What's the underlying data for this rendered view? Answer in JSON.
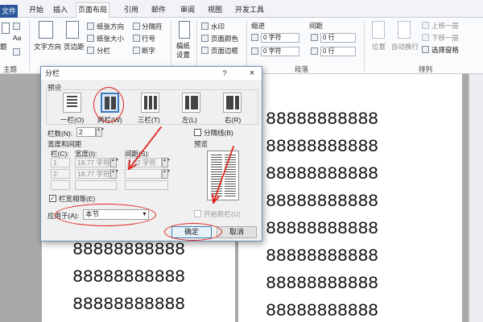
{
  "ribbon": {
    "tabs": [
      "文件",
      "开始",
      "插入",
      "页面布局",
      "引用",
      "邮件",
      "审阅",
      "视图",
      "开发工具"
    ],
    "active_tab": "页面布局",
    "page_setup": {
      "text_direction": "文字方向",
      "margins": "页边距",
      "orientation": "纸张方向",
      "size": "纸张大小",
      "columns": "分栏",
      "breaks": "分隔符",
      "line_numbers": "行号",
      "hyphenation": "断字"
    },
    "manuscript": "稿纸\n设置",
    "page_bg": {
      "watermark": "水印",
      "page_color": "页面颜色",
      "page_borders": "页面边框"
    },
    "paragraph": {
      "indent": "缩进",
      "spacing": "间距",
      "indent_left": "0 字符",
      "indent_right": "0 字符",
      "spacing_before": "0 行",
      "spacing_after": "0 行",
      "group_label": "段落"
    },
    "arrange": {
      "position": "位置",
      "wrap": "自动换行",
      "bring_forward": "上移一层",
      "send_backward": "下移一层",
      "selection_pane": "选择窗格",
      "group_label": "排列"
    },
    "left_group_label": "主题",
    "left_labels": [
      "题",
      "Aa"
    ]
  },
  "dialog": {
    "title": "分栏",
    "help": "?",
    "close": "×",
    "presets_label": "预设",
    "presets": [
      "一栏(O)",
      "两栏(W)",
      "三栏(T)",
      "左(L)",
      "右(R)"
    ],
    "num_columns_label": "栏数(N):",
    "num_columns": "2",
    "line_between_label": "分隔线(B)",
    "width_spacing_label": "宽度和间距",
    "col_header": "栏(C):",
    "width_header": "宽度(I):",
    "spacing_header": "间距(S):",
    "rows": [
      {
        "col": "1:",
        "width": "18.77 字符",
        "spacing": "2.02 字符"
      },
      {
        "col": "2:",
        "width": "18.77 字符",
        "spacing": ""
      }
    ],
    "preview_label": "预览",
    "equal_width_label": "栏宽相等(E)",
    "apply_to_label": "应用于(A):",
    "apply_to_value": "本节",
    "new_column_label": "开始新栏(U)",
    "ok": "确定",
    "cancel": "取消"
  },
  "document": {
    "line_text": "88888888888",
    "left_page_lines": 3,
    "right_page_lines": 8
  },
  "annotation_color": "#e0201c",
  "accent": "#2b579a"
}
